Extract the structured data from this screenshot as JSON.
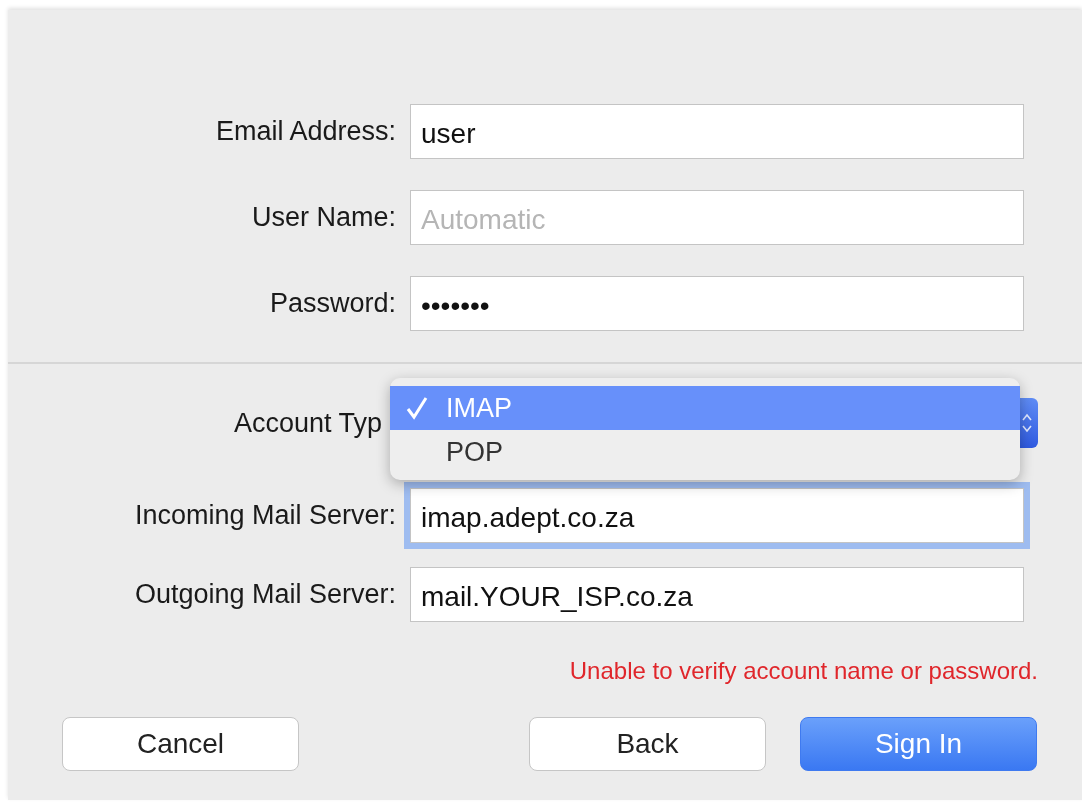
{
  "fields": [
    {
      "label": "Email Address:",
      "value": "user"
    },
    {
      "label": "User Name:",
      "placeholder": "Automatic"
    },
    {
      "label": "Password:",
      "value": "•••••••"
    }
  ],
  "account_type": {
    "label": "Account Typ",
    "menu": [
      {
        "label": "IMAP",
        "selected": true
      },
      {
        "label": "POP",
        "selected": false
      }
    ]
  },
  "servers": [
    {
      "label": "Incoming Mail Server:",
      "value": "imap.adept.co.za",
      "focused": true
    },
    {
      "label": "Outgoing Mail Server:",
      "value": "mail.YOUR_ISP.co.za",
      "focused": false
    }
  ],
  "error": "Unable to verify account name or password.",
  "buttons": [
    {
      "label": "Cancel",
      "kind": "secondary"
    },
    {
      "label": "Back",
      "kind": "secondary"
    },
    {
      "label": "Sign In",
      "kind": "primary"
    }
  ]
}
